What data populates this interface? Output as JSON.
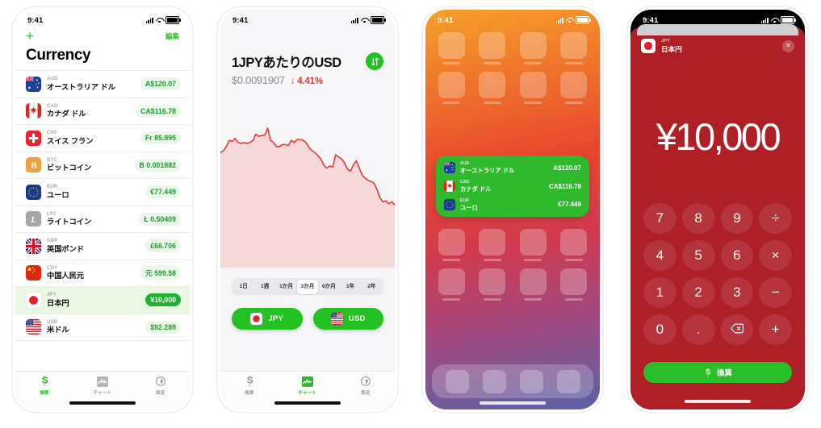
{
  "status_bar": {
    "time": "9:41"
  },
  "phone1": {
    "name": "currency-list",
    "add_label": "+",
    "edit_label": "編集",
    "title": "Currency",
    "rows": [
      {
        "code": "AUD",
        "name": "オーストラリア ドル",
        "value": "A$120.07",
        "flag": "au",
        "selected": false
      },
      {
        "code": "CAD",
        "name": "カナダ ドル",
        "value": "CA$116.78",
        "flag": "ca",
        "selected": false
      },
      {
        "code": "CHF",
        "name": "スイス フラン",
        "value": "Fr 85.895",
        "flag": "ch",
        "selected": false
      },
      {
        "code": "BTC",
        "name": "ビットコイン",
        "value": "B 0.001882",
        "flag": "btc",
        "selected": false
      },
      {
        "code": "EUR",
        "name": "ユーロ",
        "value": "€77.449",
        "flag": "eu",
        "selected": false
      },
      {
        "code": "LTC",
        "name": "ライトコイン",
        "value": "Ł 0.50409",
        "flag": "ltc",
        "selected": false
      },
      {
        "code": "GBP",
        "name": "英国ポンド",
        "value": "£66.706",
        "flag": "gb",
        "selected": false
      },
      {
        "code": "CNY",
        "name": "中国人民元",
        "value": "元 599.58",
        "flag": "cn",
        "selected": false
      },
      {
        "code": "JPY",
        "name": "日本円",
        "value": "¥10,000",
        "flag": "jp",
        "selected": true
      },
      {
        "code": "USD",
        "name": "米ドル",
        "value": "$92.289",
        "flag": "us",
        "selected": false
      }
    ],
    "tabs": [
      {
        "label": "換算",
        "icon": "convert-icon",
        "active": true
      },
      {
        "label": "チャート",
        "icon": "chart-icon",
        "active": false
      },
      {
        "label": "設定",
        "icon": "settings-icon",
        "active": false
      }
    ]
  },
  "phone2": {
    "name": "chart-screen",
    "title": "1JPYあたりのUSD",
    "price": "$0.0091907",
    "change": "↓ 4.41%",
    "swap_icon": "swap-vertical-icon",
    "ranges": [
      {
        "label": "1日",
        "active": false
      },
      {
        "label": "1週",
        "active": false
      },
      {
        "label": "1か月",
        "active": false
      },
      {
        "label": "3か月",
        "active": true
      },
      {
        "label": "6か月",
        "active": false
      },
      {
        "label": "1年",
        "active": false
      },
      {
        "label": "2年",
        "active": false
      }
    ],
    "currency_buttons": [
      {
        "label": "JPY",
        "flag": "jp"
      },
      {
        "label": "USD",
        "flag": "us"
      }
    ],
    "tabs": [
      {
        "label": "換算",
        "icon": "convert-icon",
        "active": false
      },
      {
        "label": "チャート",
        "icon": "chart-icon",
        "active": true
      },
      {
        "label": "設定",
        "icon": "settings-icon",
        "active": false
      }
    ],
    "chart_data": {
      "type": "area",
      "title": "1JPYあたりのUSD",
      "ylabel": "",
      "xlabel": "",
      "line_color": "#e8392f",
      "fill_color": "#f5d9d9",
      "grid": false,
      "range_selected": "3か月",
      "y": [
        60,
        62,
        66,
        72,
        71,
        74,
        70,
        69,
        70,
        69,
        70,
        72,
        78,
        76,
        77,
        77,
        84,
        72,
        70,
        66,
        66,
        68,
        68,
        67,
        72,
        70,
        73,
        73,
        72,
        70,
        65,
        62,
        60,
        57,
        54,
        48,
        45,
        47,
        46,
        58,
        56,
        54,
        50,
        44,
        42,
        48,
        52,
        45,
        38,
        35,
        33,
        32,
        30,
        24,
        16,
        12,
        13,
        10,
        12,
        9
      ]
    }
  },
  "phone3": {
    "name": "home-screen-widget",
    "widget_rows": [
      {
        "code": "AUD",
        "name": "オーストラリア ドル",
        "value": "A$120.07",
        "flag": "au"
      },
      {
        "code": "CAD",
        "name": "カナダ ドル",
        "value": "CA$116.78",
        "flag": "ca"
      },
      {
        "code": "EUR",
        "name": "ユーロ",
        "value": "€77.449",
        "flag": "eu"
      }
    ],
    "widget_color": "#2fba2d"
  },
  "phone4": {
    "name": "keypad-screen",
    "code": "JPY",
    "currency_name": "日本円",
    "flag": "jp",
    "close_icon": "close-icon",
    "amount": "¥10,000",
    "background_color": "#ae1f26",
    "keys": [
      {
        "label": "7",
        "kind": "digit"
      },
      {
        "label": "8",
        "kind": "digit"
      },
      {
        "label": "9",
        "kind": "digit"
      },
      {
        "label": "÷",
        "kind": "operator"
      },
      {
        "label": "4",
        "kind": "digit"
      },
      {
        "label": "5",
        "kind": "digit"
      },
      {
        "label": "6",
        "kind": "digit"
      },
      {
        "label": "×",
        "kind": "operator"
      },
      {
        "label": "1",
        "kind": "digit"
      },
      {
        "label": "2",
        "kind": "digit"
      },
      {
        "label": "3",
        "kind": "digit"
      },
      {
        "label": "−",
        "kind": "operator"
      },
      {
        "label": "0",
        "kind": "digit"
      },
      {
        "label": ".",
        "kind": "digit"
      },
      {
        "label": "⌫",
        "kind": "backspace"
      },
      {
        "label": "+",
        "kind": "operator"
      }
    ],
    "convert_label": "換算",
    "convert_color": "#2abf28"
  }
}
